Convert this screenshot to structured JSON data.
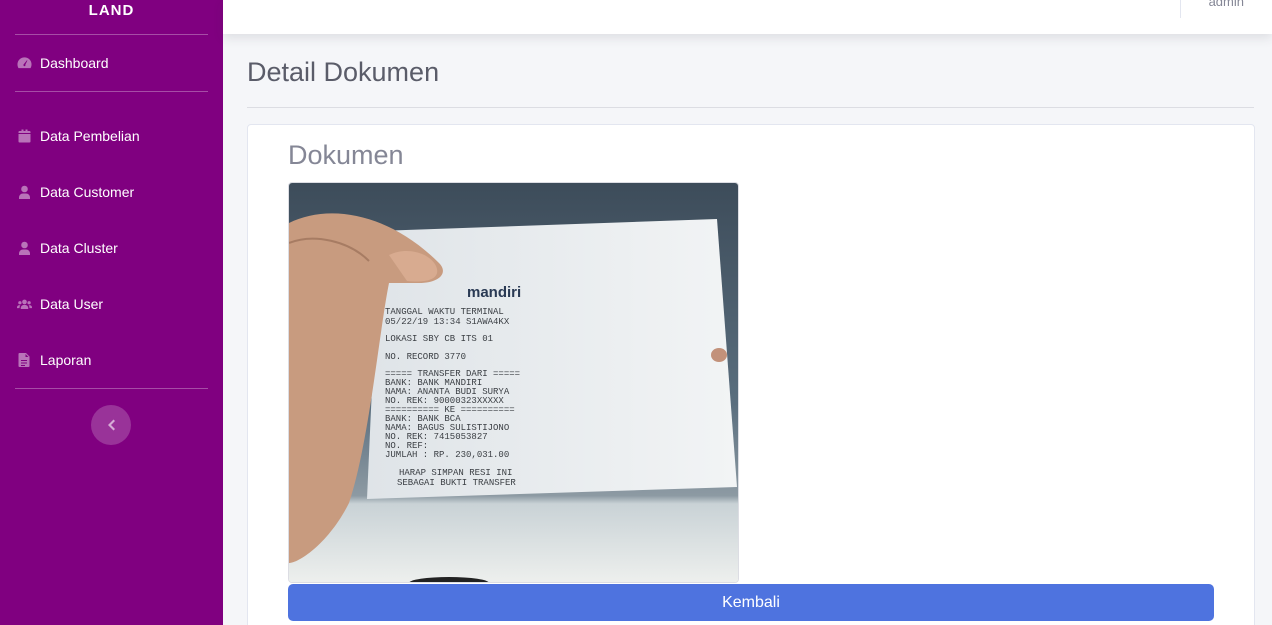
{
  "sidebar": {
    "brand": "LAND",
    "items": [
      {
        "label": "Dashboard",
        "icon": "tachometer-icon"
      },
      {
        "label": "Data Pembelian",
        "icon": "calendar-icon"
      },
      {
        "label": "Data Customer",
        "icon": "user-icon"
      },
      {
        "label": "Data Cluster",
        "icon": "user-icon"
      },
      {
        "label": "Data User",
        "icon": "users-icon"
      },
      {
        "label": "Laporan",
        "icon": "file-icon"
      }
    ],
    "toggle_icon": "chevron-left-icon",
    "background_color": "#800080"
  },
  "topbar": {
    "user_name": "admin"
  },
  "main": {
    "page_title": "Detail Dokumen",
    "card_heading": "Dokumen",
    "back_button_label": "Kembali",
    "button_color": "#4e73df"
  },
  "receipt": {
    "bank_logo": "mandiri",
    "lines": [
      "TANGGAL      WAKTU      TERMINAL",
      "05/22/19      13:34      S1AWA4KX",
      "LOKASI      SBY CB ITS 01",
      "NO. RECORD  3770",
      "===== TRANSFER DARI =====",
      "BANK: BANK MANDIRI",
      "NAMA: ANANTA BUDI SURYA",
      "NO. REK: 90000323XXXXX",
      "========== KE ==========",
      "BANK: BANK BCA",
      "NAMA: BAGUS SULISTIJONO",
      "NO. REK: 7415053827",
      "NO. REF:",
      "JUMLAH : RP.         230,031.00",
      "HARAP SIMPAN RESI INI",
      "SEBAGAI BUKTI TRANSFER"
    ]
  }
}
